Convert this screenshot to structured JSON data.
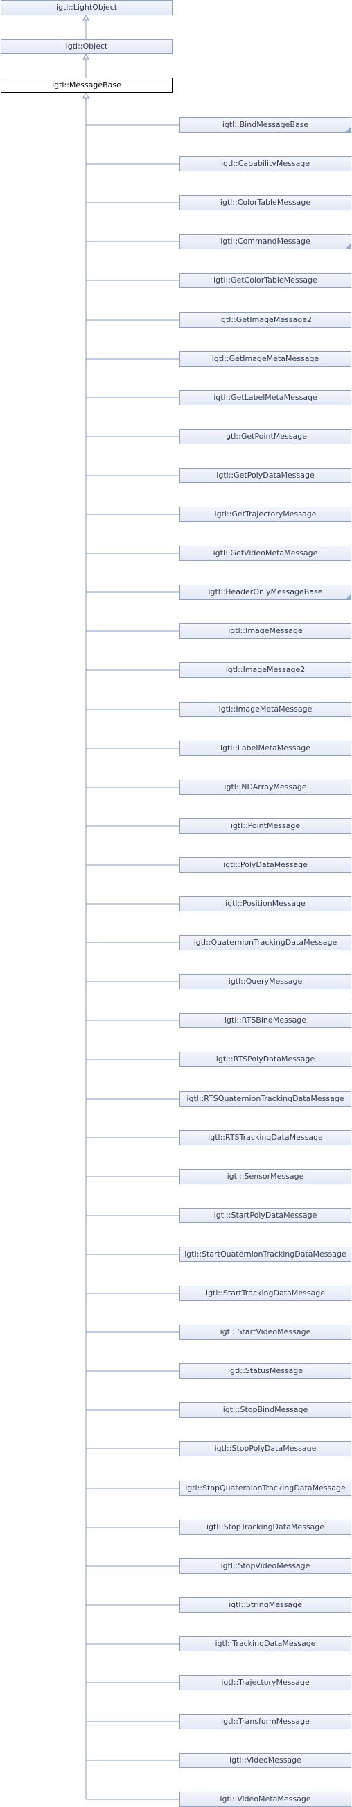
{
  "hierarchy": {
    "ancestors": [
      {
        "label": "igtl::LightObject"
      },
      {
        "label": "igtl::Object"
      }
    ],
    "current": {
      "label": "igtl::MessageBase"
    },
    "children": [
      {
        "label": "igtl::BindMessageBase",
        "has_children": true
      },
      {
        "label": "igtl::CapabilityMessage"
      },
      {
        "label": "igtl::ColorTableMessage"
      },
      {
        "label": "igtl::CommandMessage",
        "has_children": true
      },
      {
        "label": "igtl::GetColorTableMessage"
      },
      {
        "label": "igtl::GetImageMessage2"
      },
      {
        "label": "igtl::GetImageMetaMessage"
      },
      {
        "label": "igtl::GetLabelMetaMessage"
      },
      {
        "label": "igtl::GetPointMessage"
      },
      {
        "label": "igtl::GetPolyDataMessage"
      },
      {
        "label": "igtl::GetTrajectoryMessage"
      },
      {
        "label": "igtl::GetVideoMetaMessage"
      },
      {
        "label": "igtl::HeaderOnlyMessageBase",
        "has_children": true
      },
      {
        "label": "igtl::ImageMessage"
      },
      {
        "label": "igtl::ImageMessage2"
      },
      {
        "label": "igtl::ImageMetaMessage"
      },
      {
        "label": "igtl::LabelMetaMessage"
      },
      {
        "label": "igtl::NDArrayMessage"
      },
      {
        "label": "igtl::PointMessage"
      },
      {
        "label": "igtl::PolyDataMessage"
      },
      {
        "label": "igtl::PositionMessage"
      },
      {
        "label": "igtl::QuaternionTrackingDataMessage"
      },
      {
        "label": "igtl::QueryMessage"
      },
      {
        "label": "igtl::RTSBindMessage"
      },
      {
        "label": "igtl::RTSPolyDataMessage"
      },
      {
        "label": "igtl::RTSQuaternionTrackingDataMessage"
      },
      {
        "label": "igtl::RTSTrackingDataMessage"
      },
      {
        "label": "igtl::SensorMessage"
      },
      {
        "label": "igtl::StartPolyDataMessage"
      },
      {
        "label": "igtl::StartQuaternionTrackingDataMessage"
      },
      {
        "label": "igtl::StartTrackingDataMessage"
      },
      {
        "label": "igtl::StartVideoMessage"
      },
      {
        "label": "igtl::StatusMessage"
      },
      {
        "label": "igtl::StopBindMessage"
      },
      {
        "label": "igtl::StopPolyDataMessage"
      },
      {
        "label": "igtl::StopQuaternionTrackingDataMessage"
      },
      {
        "label": "igtl::StopTrackingDataMessage"
      },
      {
        "label": "igtl::StopVideoMessage"
      },
      {
        "label": "igtl::StringMessage"
      },
      {
        "label": "igtl::TrackingDataMessage"
      },
      {
        "label": "igtl::TrajectoryMessage"
      },
      {
        "label": "igtl::TransformMessage"
      },
      {
        "label": "igtl::VideoMessage"
      },
      {
        "label": "igtl::VideoMetaMessage"
      }
    ]
  },
  "colors": {
    "node_border": "#8b9fc9",
    "node_fill": "#e3e9f5",
    "current_border": "#000000",
    "connector": "#7c9bd6"
  }
}
